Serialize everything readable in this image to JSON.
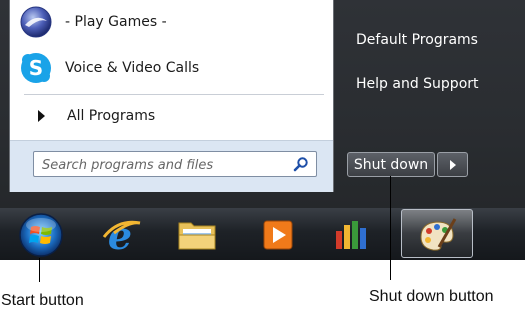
{
  "start_menu": {
    "programs": [
      {
        "label": "- Play Games -",
        "icon": "games-icon"
      },
      {
        "label": "Voice & Video Calls",
        "icon": "skype-icon"
      }
    ],
    "all_programs_label": "All Programs",
    "search": {
      "placeholder": "Search programs and files",
      "value": ""
    },
    "right_pane": {
      "items": [
        "Default Programs",
        "Help and Support"
      ]
    },
    "shutdown_label": "Shut down"
  },
  "taskbar": {
    "items": [
      {
        "name": "start-button",
        "icon": "windows-orb-icon"
      },
      {
        "name": "internet-explorer",
        "icon": "internet-explorer-icon"
      },
      {
        "name": "windows-explorer",
        "icon": "folder-icon"
      },
      {
        "name": "media-player",
        "icon": "media-player-icon"
      },
      {
        "name": "bar-app",
        "icon": "colored-bars-icon"
      },
      {
        "name": "paint",
        "icon": "paint-palette-icon"
      }
    ]
  },
  "callouts": {
    "start": "Start button",
    "shutdown": "Shut down button"
  }
}
